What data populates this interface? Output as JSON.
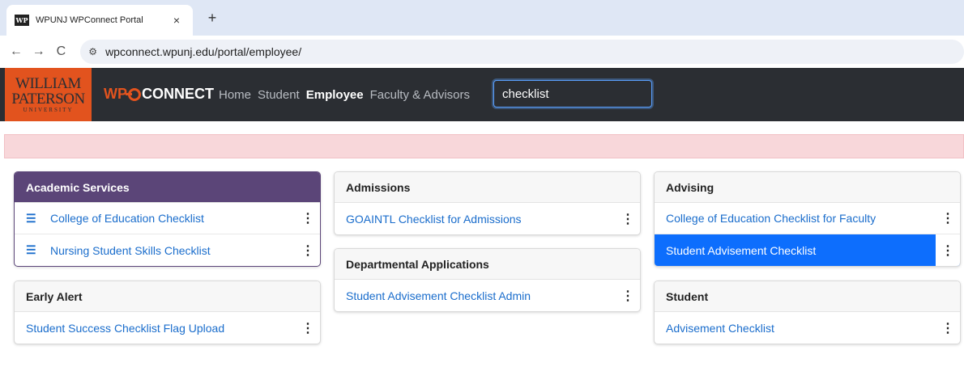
{
  "browser": {
    "tab_title": "WPUNJ WPConnect Portal",
    "tab_favicon_text": "WP",
    "close_symbol": "×",
    "new_tab_symbol": "+",
    "back_symbol": "←",
    "forward_symbol": "→",
    "reload_symbol": "C",
    "site_icon": "⚙",
    "url": "wpconnect.wpunj.edu/portal/employee/"
  },
  "header": {
    "logo": {
      "line1": "WILLIAM",
      "line2": "PATERSON",
      "line3": "UNIVERSITY"
    },
    "brand": {
      "prefix": "WP",
      "suffix": "CONNECT"
    },
    "nav": [
      "Home",
      "Student",
      "Employee",
      "Faculty & Advisors"
    ],
    "active_nav": "Employee",
    "search_value": "checklist"
  },
  "cards": {
    "academic_services": {
      "title": "Academic Services",
      "items": [
        {
          "label": "College of Education Checklist",
          "icon": "checklist-icon"
        },
        {
          "label": "Nursing Student Skills Checklist",
          "icon": "checklist-icon"
        }
      ]
    },
    "early_alert": {
      "title": "Early Alert",
      "items": [
        {
          "label": "Student Success Checklist Flag Upload"
        }
      ]
    },
    "admissions": {
      "title": "Admissions",
      "items": [
        {
          "label": "GOAINTL Checklist for Admissions"
        }
      ]
    },
    "departmental_applications": {
      "title": "Departmental Applications",
      "items": [
        {
          "label": "Student Advisement Checklist Admin"
        }
      ]
    },
    "advising": {
      "title": "Advising",
      "items": [
        {
          "label": "College of Education Checklist for Faculty"
        },
        {
          "label": "Student Advisement Checklist",
          "selected": true
        }
      ]
    },
    "student": {
      "title": "Student",
      "items": [
        {
          "label": "Advisement Checklist"
        }
      ]
    }
  },
  "icons": {
    "checklist_glyph": "☰",
    "kebab_glyph": "⋮"
  },
  "colors": {
    "header_bg": "#2b2e33",
    "brand_orange": "#e2531e",
    "academic_header": "#5b4578",
    "link": "#1a6dcc",
    "selected": "#0d6efd",
    "alert_bg": "#f8d7da"
  }
}
